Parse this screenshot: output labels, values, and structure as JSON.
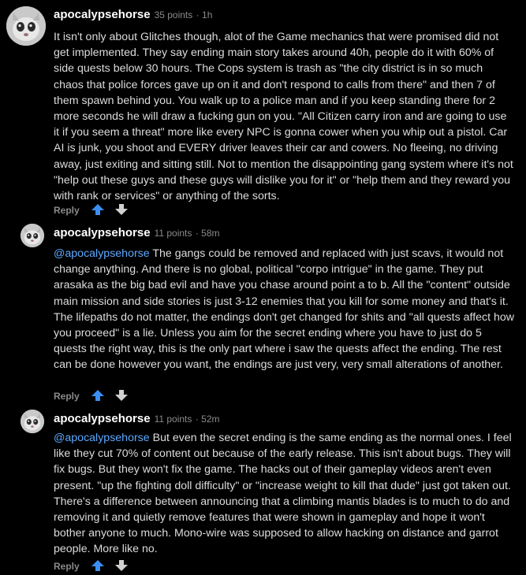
{
  "colors": {
    "background": "#000000",
    "username": "#ffffff",
    "body_text": "#dcdcdc",
    "meta": "#8a8a8a",
    "mention": "#5ba8ff",
    "upvote": "#3b8ef2",
    "downvote": "#d0d0d0"
  },
  "comments": [
    {
      "username": "apocalypsehorse",
      "points": "35 points",
      "time": "· 1h",
      "mention": "",
      "text": "It isn't only about Glitches though, alot of the Game mechanics that were promised did not get implemented. They say ending main story takes around 40h, people do it with 60% of side quests below 30 hours. The Cops system is trash as \"the city district is in so much chaos that police forces gave up on it and don't respond to calls from there\" and then 7 of them spawn behind you. You walk up to a police man and if you keep standing there for 2 more seconds he will draw a fucking gun on you. \"All Citizen carry iron and are going to use it if you seem a threat\" more like every NPC is gonna cower when you whip out a pistol. Car AI is junk, you shoot and EVERY driver leaves their car and cowers. No fleeing, no driving away, just exiting and sitting still. Not to mention the disappointing gang system where it's not \"help out these guys and these guys will dislike you for it\" or \"help them and they reward you with rank or services\" or anything of the sorts.",
      "reply": "Reply",
      "upvote_icon": "upvote-arrow-icon",
      "downvote_icon": "downvote-arrow-icon"
    },
    {
      "username": "apocalypsehorse",
      "points": "11 points",
      "time": "· 58m",
      "mention": "@apocalypsehorse",
      "text": " The gangs could be removed and replaced with just scavs, it would not change anything. And there is no global, political \"corpo intrigue\" in the game. They put arasaka as the big bad evil and have you chase around point a to b. All the \"content\" outside main mission and side stories is just 3-12 enemies that you kill for some money and that's it. The lifepaths do not matter, the endings don't get changed for shits and \"all quests affect how you proceed\" is a lie. Unless you aim for the secret ending where you have to just do 5 quests the right way, this is the only part where i saw the quests affect the ending. The rest can be done however you want, the endings are just very, very small alterations of another.",
      "reply": "Reply",
      "upvote_icon": "upvote-arrow-icon",
      "downvote_icon": "downvote-arrow-icon"
    },
    {
      "username": "apocalypsehorse",
      "points": "11 points",
      "time": "· 52m",
      "mention": "@apocalypsehorse",
      "text": " But even the secret ending is the same ending as the normal ones. I feel like they cut 70% of content out because of the early release. This isn't about bugs. They will fix bugs. But they won't fix the game. The hacks out of their gameplay videos aren't even present. \"up the fighting doll difficulty\" or \"increase weight to kill that dude\" just got taken out. There's a difference between announcing that a climbing mantis blades is to much to do and removing it and quietly remove features that were shown in gameplay and hope it won't bother anyone to much. Mono-wire was supposed to allow hacking on distance and garrot people. More like no.",
      "reply": "Reply",
      "upvote_icon": "upvote-arrow-icon",
      "downvote_icon": "downvote-arrow-icon"
    }
  ]
}
